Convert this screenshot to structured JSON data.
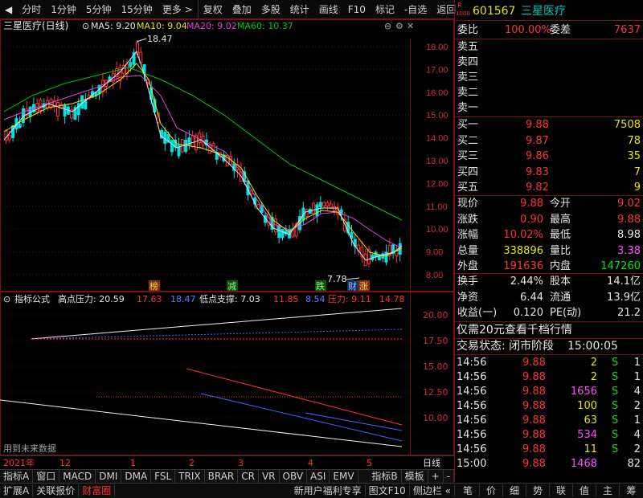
{
  "toolbar": {
    "items": [
      "分时",
      "1分钟",
      "5分钟",
      "15分钟",
      "更多 >",
      "复权",
      "叠加",
      "多股",
      "统计",
      "画线",
      "F10",
      "标记",
      "-自选",
      "返回"
    ]
  },
  "chart_header": {
    "title": "三星医疗(日线)",
    "ma5": "MA5: 9.20",
    "ma10": "MA10: 9.04",
    "ma20": "MA20: 9.02",
    "ma60": "MA60: 10.37",
    "high_marker": "18.47",
    "low_marker": "7.78"
  },
  "price_axis": [
    "18.00",
    "17.00",
    "16.00",
    "15.00",
    "14.00",
    "13.00",
    "12.00",
    "11.00",
    "10.00",
    "9.00",
    "8.00"
  ],
  "event_labels": [
    "榜",
    "减",
    "跌",
    "财",
    "涨"
  ],
  "indicator": {
    "name": "指标公式",
    "high_label": "高点压力: 20.59",
    "high_v1": "17.63",
    "high_v2": "18.47",
    "low_label": "低点支撑: 7.03",
    "low_v1": "11.85",
    "low_v2": "8.54",
    "press_label": "压力: 9.11",
    "press_v": "14.78",
    "axis": [
      "20.00",
      "17.50",
      "15.00",
      "12.50",
      "10.00"
    ],
    "note": "用到未来数据"
  },
  "date_axis": [
    "2021年",
    "12",
    "1",
    "2",
    "3",
    "4",
    "5"
  ],
  "date_axis_right": "日线",
  "bottom_tabs": [
    "指标A",
    "窗口",
    "MACD",
    "DMI",
    "DMA",
    "FSL",
    "TRIX",
    "BRAR",
    "CR",
    "VR",
    "OBV",
    "ASI",
    "EMV",
    "指标B",
    "模板",
    "+",
    "-"
  ],
  "bottom_tabs2": [
    "扩展A",
    "关联报价",
    "财富圈"
  ],
  "bottom_ads": [
    "新用户福利专享",
    "图文F10",
    "侧边栏 «"
  ],
  "right_bottom": [
    "笔",
    "价",
    "细",
    "势",
    "联",
    "值",
    "主",
    "筹"
  ],
  "stock": {
    "badge_top": "R",
    "badge_bot": "1000",
    "code": "601567",
    "name": "三星医疗"
  },
  "weibi": {
    "label": "委比",
    "value": "100.00%",
    "label2": "委差",
    "value2": "7637"
  },
  "sell": [
    "卖五",
    "卖四",
    "卖三",
    "卖二",
    "卖一"
  ],
  "buy": [
    {
      "label": "买一",
      "price": "9.88",
      "vol": "7508"
    },
    {
      "label": "买二",
      "price": "9.87",
      "vol": "78"
    },
    {
      "label": "买三",
      "price": "9.86",
      "vol": "35"
    },
    {
      "label": "买四",
      "price": "9.83",
      "vol": "7"
    },
    {
      "label": "买五",
      "price": "9.82",
      "vol": "9"
    }
  ],
  "quote": [
    {
      "l1": "现价",
      "v1": "9.88",
      "l2": "今开",
      "v2": "9.02"
    },
    {
      "l1": "涨跌",
      "v1": "0.90",
      "l2": "最高",
      "v2": "9.88"
    },
    {
      "l1": "涨幅",
      "v1": "10.02%",
      "l2": "最低",
      "v2": "8.98"
    },
    {
      "l1": "总量",
      "v1": "338896",
      "l2": "量比",
      "v2": "3.38"
    },
    {
      "l1": "外盘",
      "v1": "191636",
      "l2": "内盘",
      "v2": "147260"
    }
  ],
  "fin": [
    {
      "l1": "换手",
      "v1": "2.44%",
      "l2": "股本",
      "v2": "14.1亿"
    },
    {
      "l1": "净资",
      "v1": "6.44",
      "l2": "流通",
      "v2": "13.9亿"
    },
    {
      "l1": "收益(一)",
      "v1": "0.120",
      "l2": "PE(动)",
      "v2": "21.2"
    }
  ],
  "promo": "仅需20元查看千档行情",
  "trade_status": {
    "label": "交易状态: 闭市阶段",
    "time": "15:00:05"
  },
  "ticks": [
    {
      "t": "14:56",
      "p": "9.88",
      "v": "2",
      "s": "S",
      "n": "1"
    },
    {
      "t": "14:56",
      "p": "9.88",
      "v": "2",
      "s": "S",
      "n": "1"
    },
    {
      "t": "14:56",
      "p": "9.88",
      "v": "1656",
      "s": "S",
      "n": "4"
    },
    {
      "t": "14:56",
      "p": "9.88",
      "v": "100",
      "s": "S",
      "n": "2"
    },
    {
      "t": "14:56",
      "p": "9.88",
      "v": "63",
      "s": "S",
      "n": "1"
    },
    {
      "t": "14:56",
      "p": "9.88",
      "v": "534",
      "s": "S",
      "n": "4"
    },
    {
      "t": "14:56",
      "p": "9.88",
      "v": "11",
      "s": "S",
      "n": "2"
    },
    {
      "t": "15:00",
      "p": "9.88",
      "v": "1468",
      "s": "",
      "n": "82"
    }
  ]
}
